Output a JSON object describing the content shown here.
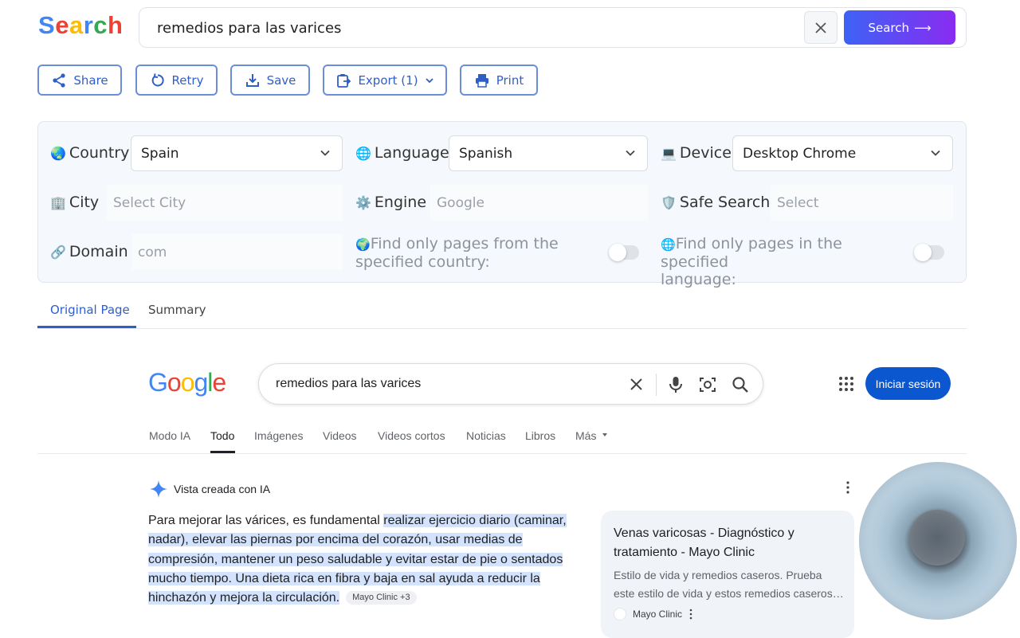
{
  "app": {
    "logo_letters": [
      "S",
      "e",
      "a",
      "r",
      "c",
      "h"
    ],
    "query": "remedios para las varices",
    "search_button": "Search",
    "search_arrow": "⟶"
  },
  "actions": {
    "share": "Share",
    "retry": "Retry",
    "save": "Save",
    "export": "Export (1)",
    "print": "Print"
  },
  "options": {
    "country": {
      "label": "Country",
      "icon": "🌏",
      "value": "Spain"
    },
    "language": {
      "label": "Language",
      "icon": "🌐",
      "value": "Spanish"
    },
    "device": {
      "label": "Device",
      "icon": "💻",
      "value": "Desktop Chrome"
    },
    "city": {
      "label": "City",
      "icon": "🏢",
      "placeholder": "Select City"
    },
    "engine": {
      "label": "Engine",
      "icon": "⚙️",
      "placeholder": "Google"
    },
    "safe_search": {
      "label": "Safe Search",
      "icon": "🛡️",
      "placeholder": "Select"
    },
    "domain": {
      "label": "Domain",
      "icon": "🔗",
      "placeholder": "com"
    },
    "country_only": {
      "icon": "🌍",
      "text_line1": "Find only pages from the",
      "text_line2": "specified country:",
      "enabled": false
    },
    "language_only": {
      "icon": "🌐",
      "text_line1": "Find only pages in the specified",
      "text_line2": "language:",
      "enabled": false
    }
  },
  "page_tabs": {
    "original": "Original Page",
    "summary": "Summary",
    "active": "Original Page"
  },
  "google": {
    "logo_letters": [
      "G",
      "o",
      "o",
      "g",
      "l",
      "e"
    ],
    "query": "remedios para las varices",
    "signin": "Iniciar sesión",
    "tabs": [
      "Modo IA",
      "Todo",
      "Imágenes",
      "Videos",
      "Videos cortos",
      "Noticias",
      "Libros",
      "Más"
    ],
    "active_tab": "Todo",
    "ai_header": "Vista creada con IA",
    "ai_intro": "Para mejorar las várices, es fundamental ",
    "ai_highlight": "realizar ejercicio diario (caminar, nadar), elevar las piernas por encima del corazón, usar medias de compresión, mantener un peso saludable y evitar estar de pie o sentados mucho tiempo. Una dieta rica en fibra y baja en sal ayuda a reducir la hinchazón y mejora la circulación.",
    "ai_chip": "Mayo Clinic +3",
    "card": {
      "title": "Venas varicosas - Diagnóstico y tratamiento - Mayo Clinic",
      "snippet_line1": "Estilo de vida y remedios caseros. Prueba",
      "snippet_line2": "este estilo de vida y estos remedios caseros…",
      "source": "Mayo Clinic"
    }
  },
  "colors": {
    "accent": "#2f5fc4",
    "search_gradient_start": "#3c63f4",
    "search_gradient_end": "#8a2bf2",
    "google_blue": "#0b57d0",
    "highlight": "#d3e3fd"
  }
}
